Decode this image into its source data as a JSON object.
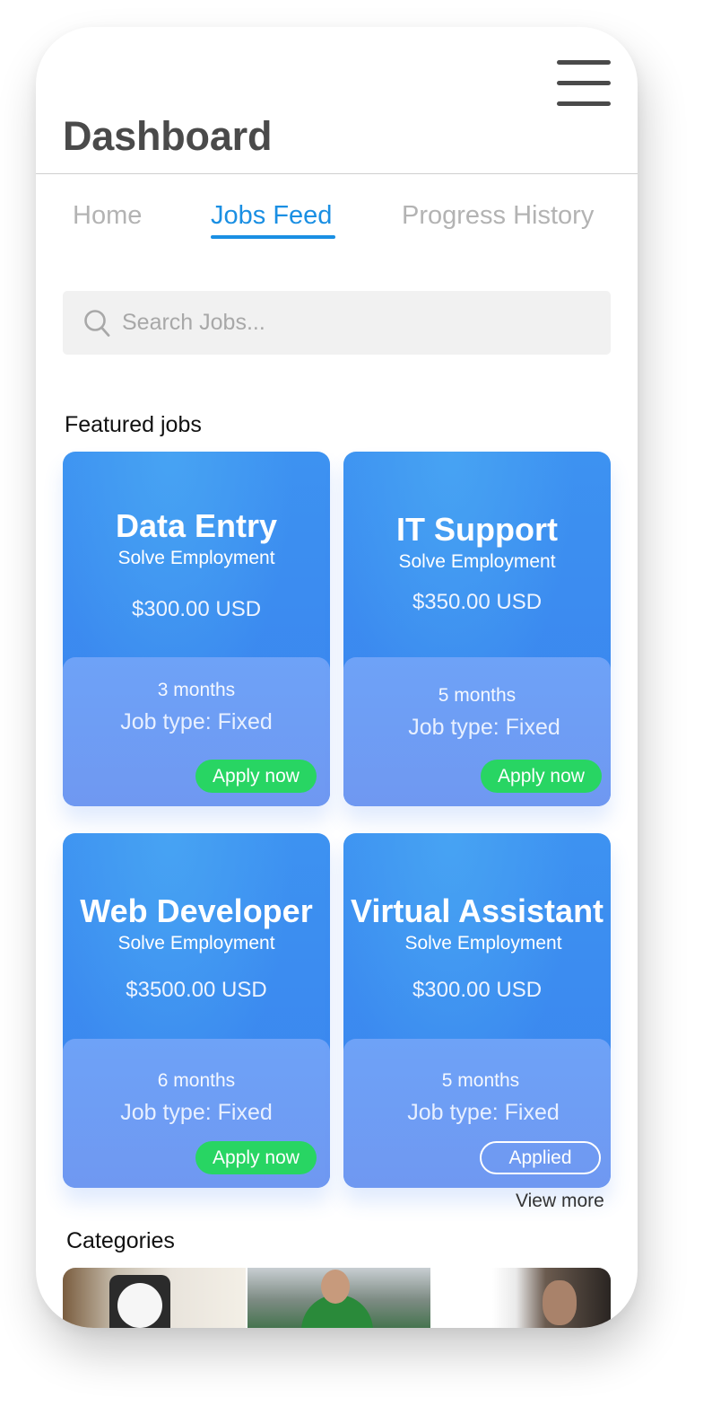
{
  "header": {
    "title": "Dashboard",
    "menu_icon": "hamburger-menu-icon"
  },
  "tabs": [
    {
      "label": "Home",
      "active": false
    },
    {
      "label": "Jobs Feed",
      "active": true
    },
    {
      "label": "Progress History",
      "active": false
    }
  ],
  "search": {
    "placeholder": "Search Jobs...",
    "value": "",
    "icon": "search-icon"
  },
  "featured": {
    "title": "Featured jobs",
    "jobs": [
      {
        "title": "Data Entry",
        "company": "Solve Employment",
        "price": "$300.00 USD",
        "duration": "3 months",
        "job_type": "Job type: Fixed",
        "action": "Apply now",
        "applied": false
      },
      {
        "title": "IT Support",
        "company": "Solve Employment",
        "price": "$350.00 USD",
        "duration": "5 months",
        "job_type": "Job type: Fixed",
        "action": "Apply now",
        "applied": false
      },
      {
        "title": "Web Developer",
        "company": "Solve Employment",
        "price": "$3500.00 USD",
        "duration": "6 months",
        "job_type": "Job type: Fixed",
        "action": "Apply now",
        "applied": false
      },
      {
        "title": "Virtual Assistant",
        "company": "Solve Employment",
        "price": "$300.00 USD",
        "duration": "5 months",
        "job_type": "Job type: Fixed",
        "action": "Applied",
        "applied": true
      }
    ],
    "view_more": "View more"
  },
  "categories": {
    "title": "Categories"
  },
  "colors": {
    "accent": "#1a8fe3",
    "card_blue": "#3d92f1",
    "apply_green": "#28d563"
  }
}
